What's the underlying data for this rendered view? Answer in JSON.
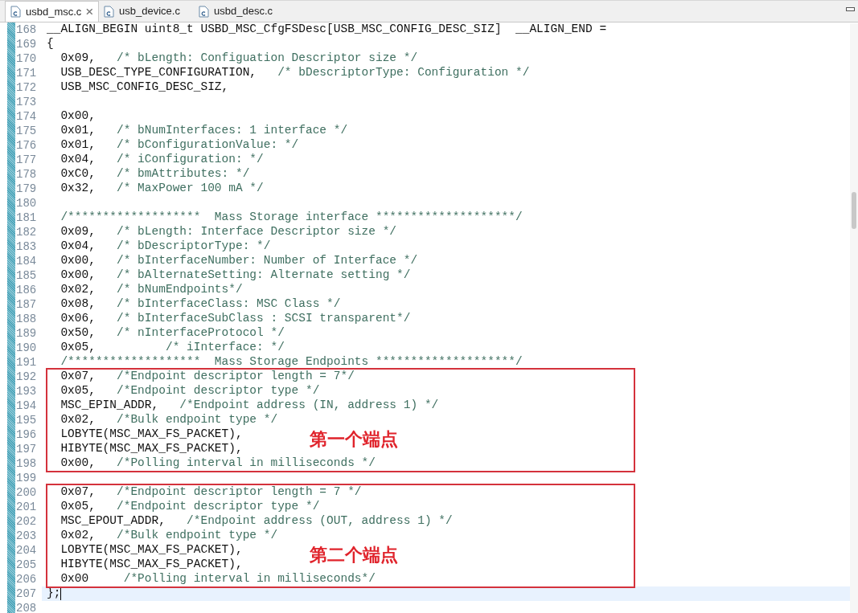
{
  "tabs": [
    {
      "label": "usbd_msc.c",
      "selected": true
    },
    {
      "label": "usb_device.c",
      "selected": false
    },
    {
      "label": "usbd_desc.c",
      "selected": false
    }
  ],
  "blocks": [
    {
      "lines": [
        {
          "number": "168",
          "code": "__ALIGN_BEGIN uint8_t USBD_MSC_CfgFSDesc[USB_MSC_CONFIG_DESC_SIZ]  __ALIGN_END =",
          "current": false
        },
        {
          "number": "169",
          "code": "{",
          "current": false
        },
        {
          "number": "170",
          "code": "  0x09,   ",
          "comment": "/* bLength: Configuation Descriptor size */",
          "current": false
        },
        {
          "number": "171",
          "code": "  USB_DESC_TYPE_CONFIGURATION,   ",
          "comment": "/* bDescriptorType: Configuration */",
          "current": false
        },
        {
          "number": "172",
          "code": "  USB_MSC_CONFIG_DESC_SIZ,",
          "current": false
        },
        {
          "number": "173",
          "current": false
        },
        {
          "number": "174",
          "code": "  0x00,",
          "current": false
        },
        {
          "number": "175",
          "code": "  0x01,   ",
          "comment": "/* bNumInterfaces: 1 interface */",
          "current": false
        },
        {
          "number": "176",
          "code": "  0x01,   ",
          "comment": "/* bConfigurationValue: */",
          "current": false
        },
        {
          "number": "177",
          "code": "  0x04,   ",
          "comment": "/* iConfiguration: */",
          "current": false
        },
        {
          "number": "178",
          "code": "  0xC0,   ",
          "comment": "/* bmAttributes: */",
          "current": false
        },
        {
          "number": "179",
          "code": "  0x32,   ",
          "comment": "/* MaxPower 100 mA */",
          "current": false
        },
        {
          "number": "180",
          "current": false
        },
        {
          "number": "181",
          "comment": "/*******************  Mass Storage interface ********************/",
          "current": false
        },
        {
          "number": "182",
          "code": "  0x09,   ",
          "comment": "/* bLength: Interface Descriptor size */",
          "current": false
        },
        {
          "number": "183",
          "code": "  0x04,   ",
          "comment": "/* bDescriptorType: */",
          "current": false
        },
        {
          "number": "184",
          "code": "  0x00,   ",
          "comment": "/* bInterfaceNumber: Number of Interface */",
          "current": false
        },
        {
          "number": "185",
          "code": "  0x00,   ",
          "comment": "/* bAlternateSetting: Alternate setting */",
          "current": false
        },
        {
          "number": "186",
          "code": "  0x02,   ",
          "comment": "/* bNumEndpoints*/",
          "current": false
        },
        {
          "number": "187",
          "code": "  0x08,   ",
          "comment": "/* bInterfaceClass: MSC Class */",
          "current": false
        },
        {
          "number": "188",
          "code": "  0x06,   ",
          "comment": "/* bInterfaceSubClass : SCSI transparent*/",
          "current": false
        },
        {
          "number": "189",
          "code": "  0x50,   ",
          "comment": "/* nInterfaceProtocol */",
          "current": false
        },
        {
          "number": "190",
          "code": "  0x05,          ",
          "comment": "/* iInterface: */",
          "current": false
        },
        {
          "number": "191",
          "comment": "/*******************  Mass Storage Endpoints ********************/",
          "current": false
        }
      ]
    },
    {
      "annotation": "第一个端点",
      "lines": [
        {
          "number": "192",
          "code": "  0x07,   ",
          "comment": "/*Endpoint descriptor length = 7*/",
          "current": false
        },
        {
          "number": "193",
          "code": "  0x05,   ",
          "comment": "/*Endpoint descriptor type */",
          "current": false
        },
        {
          "number": "194",
          "code": "  MSC_EPIN_ADDR,   ",
          "comment": "/*Endpoint address (IN, address 1) */",
          "current": false
        },
        {
          "number": "195",
          "code": "  0x02,   ",
          "comment": "/*Bulk endpoint type */",
          "current": false
        },
        {
          "number": "196",
          "code": "  LOBYTE(MSC_MAX_FS_PACKET),",
          "current": false
        },
        {
          "number": "197",
          "code": "  HIBYTE(MSC_MAX_FS_PACKET),",
          "current": false
        },
        {
          "number": "198",
          "code": "  0x00,   ",
          "comment": "/*Polling interval in milliseconds */",
          "current": false
        }
      ]
    },
    {
      "lines": [
        {
          "number": "199",
          "current": false
        }
      ]
    },
    {
      "annotation": "第二个端点",
      "lines": [
        {
          "number": "200",
          "code": "  0x07,   ",
          "comment": "/*Endpoint descriptor length = 7 */",
          "current": false
        },
        {
          "number": "201",
          "code": "  0x05,   ",
          "comment": "/*Endpoint descriptor type */",
          "current": false
        },
        {
          "number": "202",
          "code": "  MSC_EPOUT_ADDR,   ",
          "comment": "/*Endpoint address (OUT, address 1) */",
          "current": false
        },
        {
          "number": "203",
          "code": "  0x02,   ",
          "comment": "/*Bulk endpoint type */",
          "current": false
        },
        {
          "number": "204",
          "code": "  LOBYTE(MSC_MAX_FS_PACKET),",
          "current": false
        },
        {
          "number": "205",
          "code": "  HIBYTE(MSC_MAX_FS_PACKET),",
          "current": false
        },
        {
          "number": "206",
          "code": "  0x00     ",
          "comment": "/*Polling interval in milliseconds*/",
          "current": false
        }
      ]
    },
    {
      "lines": [
        {
          "number": "207",
          "code": "};",
          "current": true
        },
        {
          "number": "208",
          "current": false
        }
      ]
    }
  ]
}
